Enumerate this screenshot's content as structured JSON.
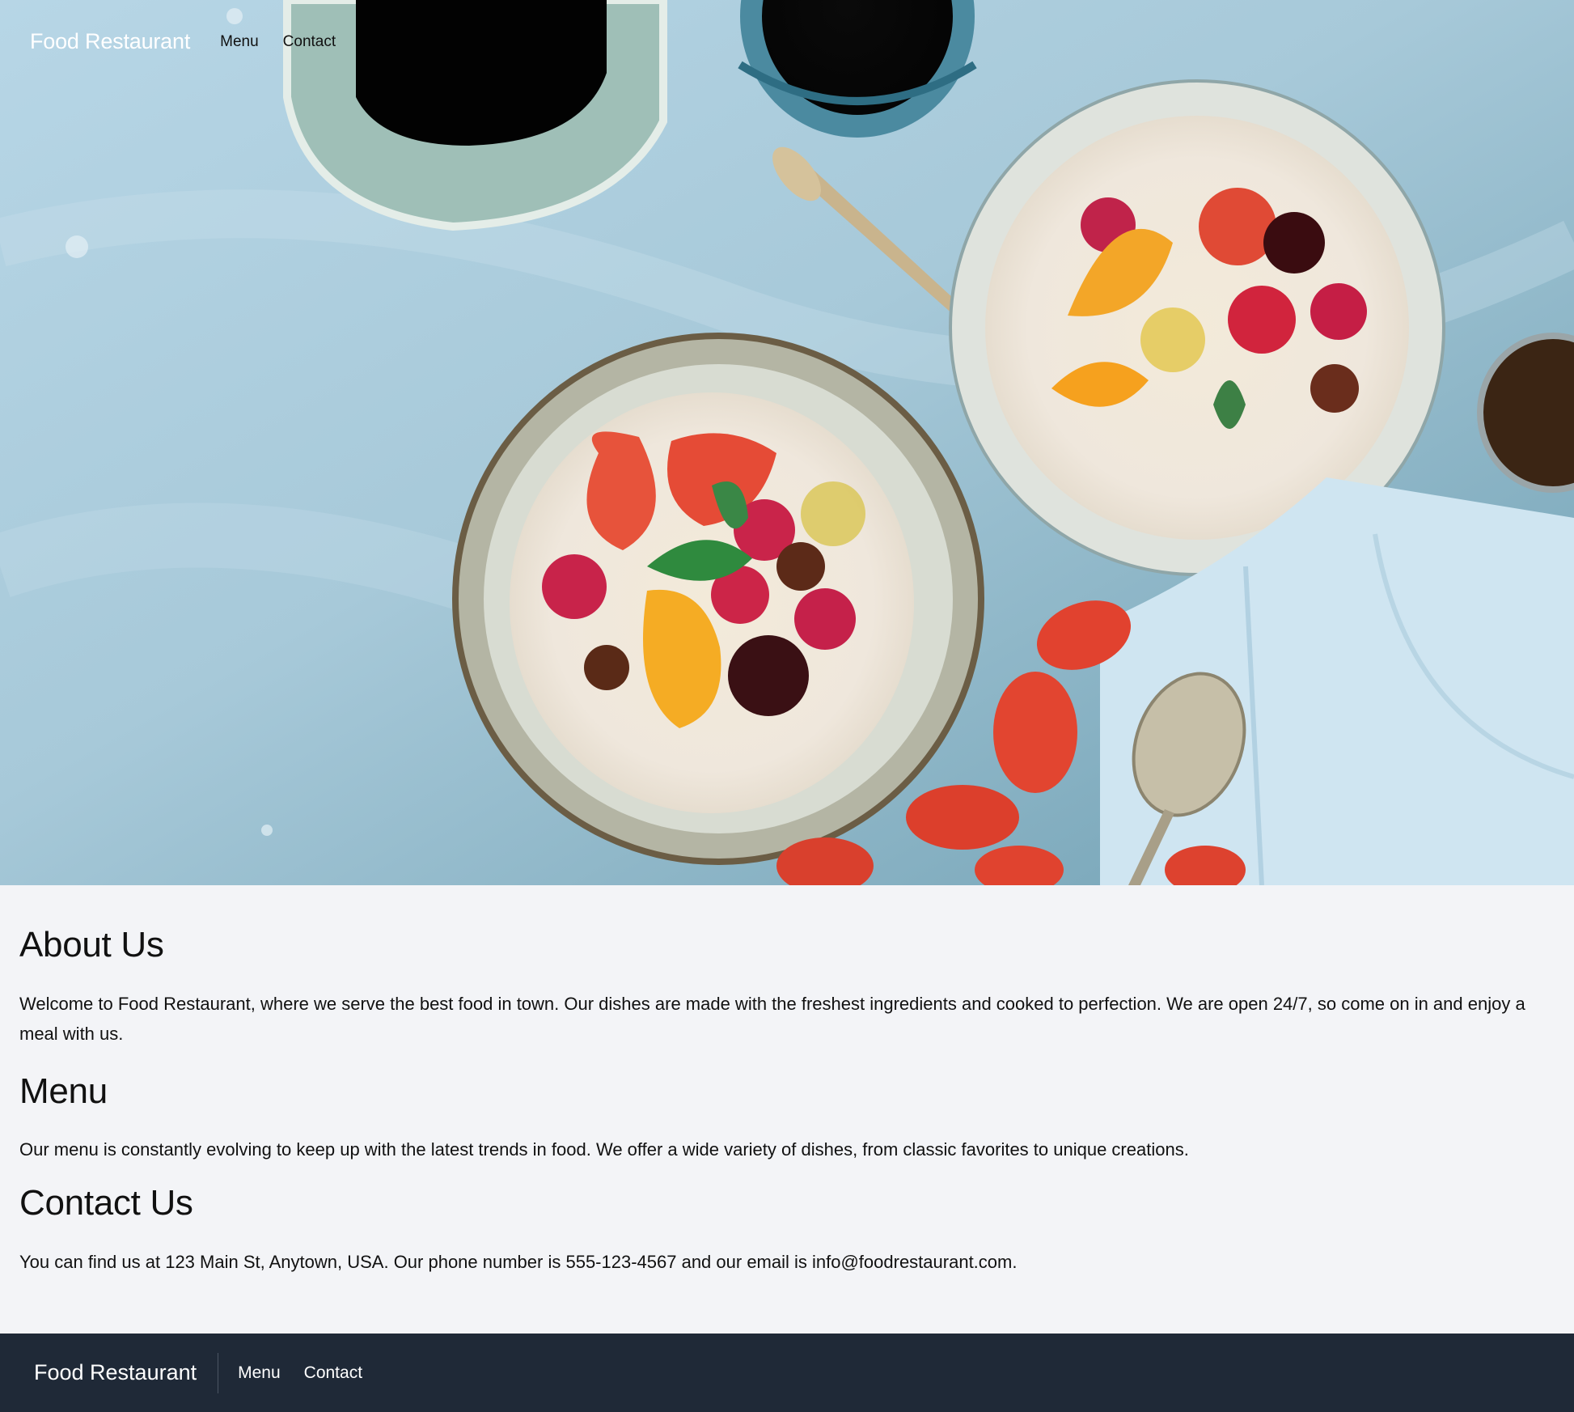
{
  "header": {
    "brand": "Food Restaurant",
    "nav": [
      {
        "label": "Menu"
      },
      {
        "label": "Contact"
      }
    ]
  },
  "hero": {
    "image_description": "Overhead photo of two bowls of oatmeal topped with strawberries, raspberries, orange slices, cherries, passion fruit, mint and star anise, with pitcher, cups, spoons and a light blue napkin on a blue textured table"
  },
  "main": {
    "sections": [
      {
        "heading": "About Us",
        "text": "Welcome to Food Restaurant, where we serve the best food in town. Our dishes are made with the freshest ingredients and cooked to perfection. We are open 24/7, so come on in and enjoy a meal with us."
      },
      {
        "heading": "Menu",
        "text": "Our menu is constantly evolving to keep up with the latest trends in food. We offer a wide variety of dishes, from classic favorites to unique creations."
      },
      {
        "heading": "Contact Us",
        "text": "You can find us at 123 Main St, Anytown, USA. Our phone number is 555-123-4567 and our email is info@foodrestaurant.com."
      }
    ]
  },
  "footer": {
    "brand": "Food Restaurant",
    "nav": [
      {
        "label": "Menu"
      },
      {
        "label": "Contact"
      }
    ]
  },
  "colors": {
    "page_background": "#f3f4f7",
    "footer_background": "#1f2937",
    "footer_text": "#ffffff",
    "body_text": "#111111"
  }
}
